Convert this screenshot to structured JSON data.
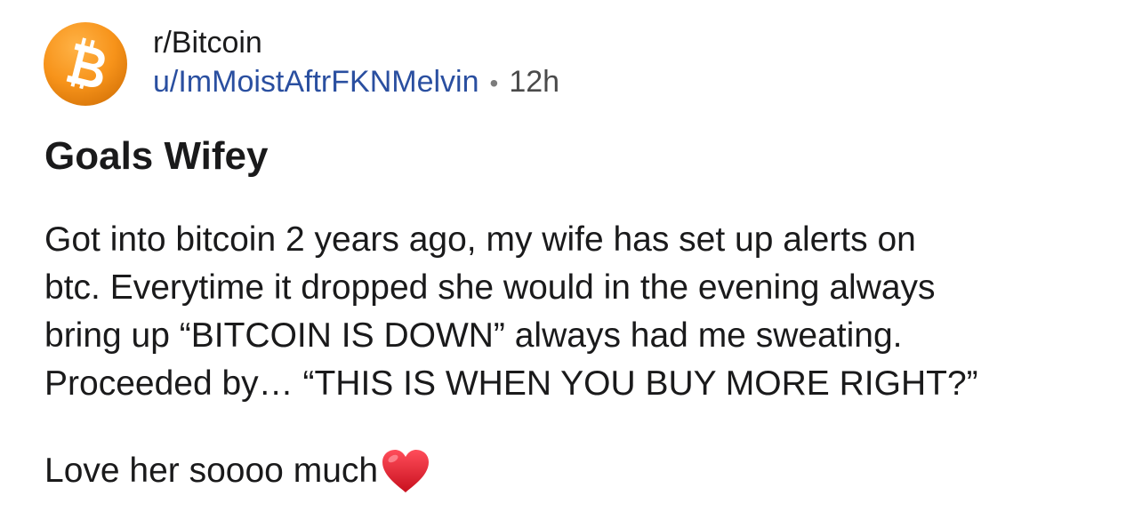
{
  "header": {
    "subreddit": "r/Bitcoin",
    "author": "u/ImMoistAftrFKNMelvin",
    "separator": "•",
    "time": "12h",
    "avatar_icon": "bitcoin-logo-icon",
    "avatar_color": "#f7931a"
  },
  "post": {
    "title": "Goals Wifey",
    "body_lines": [
      "Got into bitcoin 2 years ago, my wife has set up alerts on",
      "btc. Everytime it dropped she would in the evening always",
      "bring up “BITCOIN IS DOWN” always had me sweating.",
      "Proceeded by… “THIS IS WHEN YOU BUY MORE RIGHT?”"
    ],
    "closing": "Love her soooo much",
    "closing_icon": "red-heart-icon",
    "heart_color": "#e0202e"
  }
}
